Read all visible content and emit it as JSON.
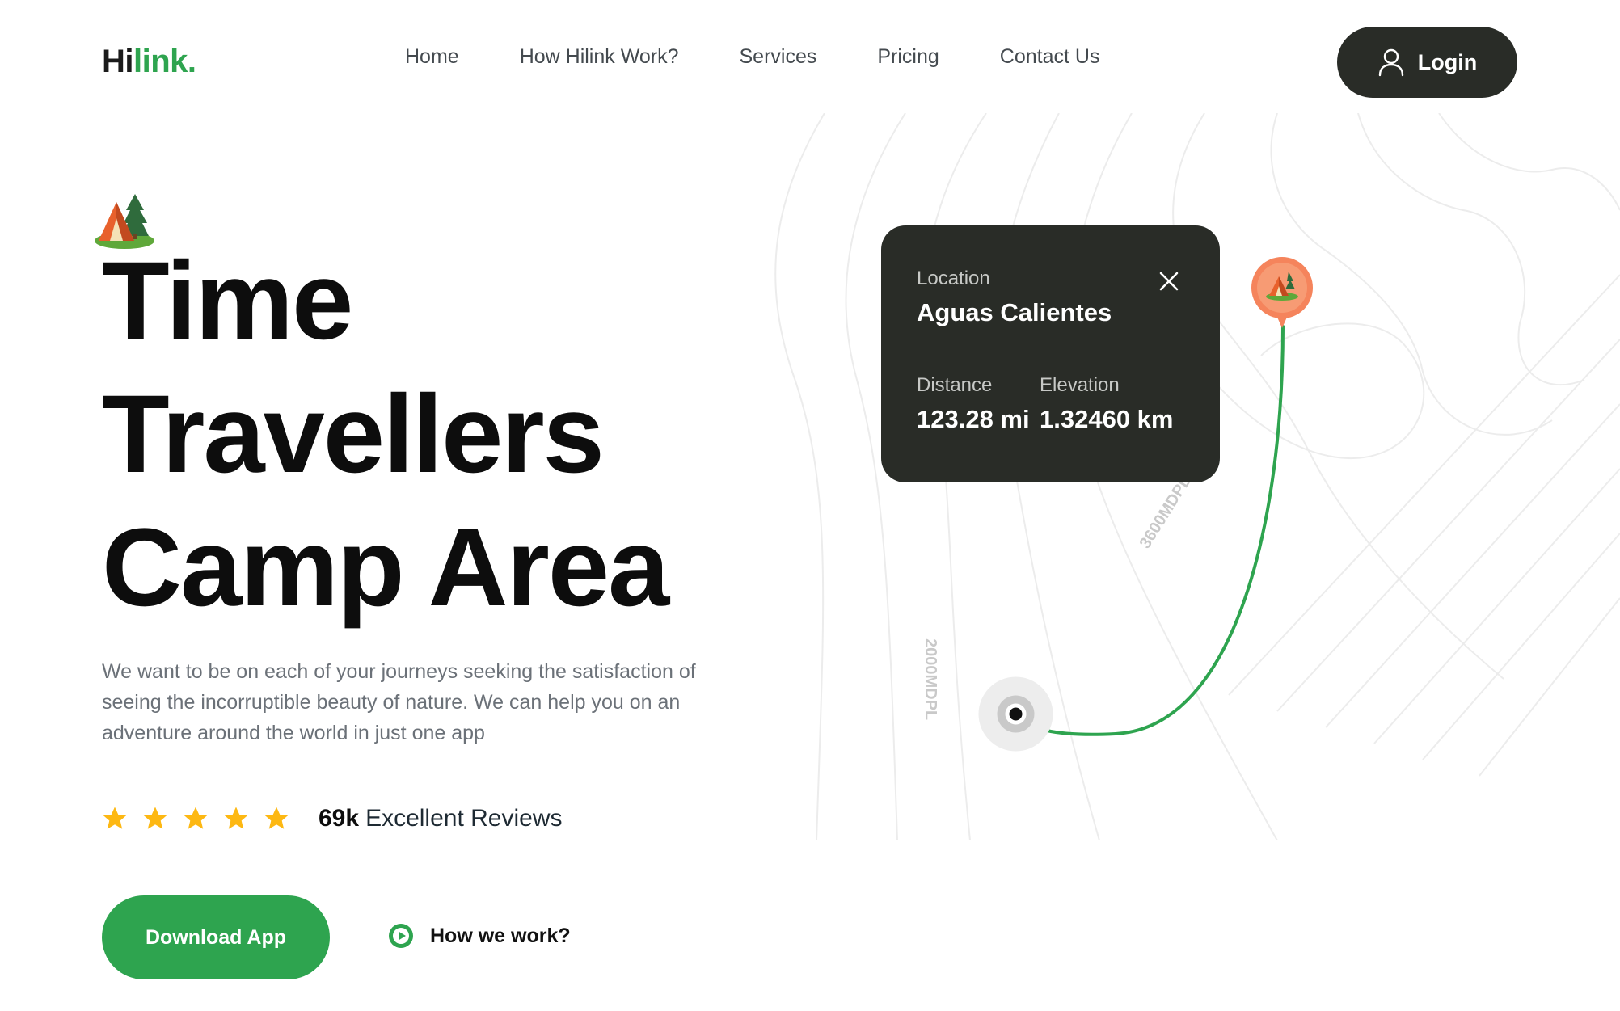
{
  "header": {
    "logo": {
      "part1": "Hi",
      "part2": "link",
      "part3": "."
    },
    "nav": [
      {
        "label": "Home"
      },
      {
        "label": "How Hilink Work?"
      },
      {
        "label": "Services"
      },
      {
        "label": "Pricing"
      },
      {
        "label": "Contact Us"
      }
    ],
    "login_label": "Login",
    "login_icon": "user-icon"
  },
  "hero": {
    "decoration_icon": "camping-tent-icon",
    "title_lines": [
      "Time",
      "Travellers",
      "Camp Area"
    ],
    "description": "We want to be on each of your journeys seeking the satisfaction of seeing the incorruptible beauty of nature. We can help you on an adventure around the world in just one app",
    "rating": {
      "stars": 5,
      "count": "69k",
      "label": "Excellent Reviews"
    },
    "download_label": "Download App",
    "how_label": "How we work?",
    "how_icon": "play-circle-icon"
  },
  "map": {
    "contour_labels": [
      "3600MDPL",
      "2000MDPL"
    ],
    "card": {
      "location_label": "Location",
      "location_name": "Aguas Calientes",
      "distance_label": "Distance",
      "distance_value": "123.28 mi",
      "elevation_label": "Elevation",
      "elevation_value": "1.32460 km"
    },
    "destination_icon": "tent-pin-icon",
    "origin_icon": "origin-marker-icon"
  },
  "colors": {
    "brand_green": "#2ea44f",
    "dark": "#292c27",
    "star": "#fdb813",
    "pin": "#f5845c"
  }
}
